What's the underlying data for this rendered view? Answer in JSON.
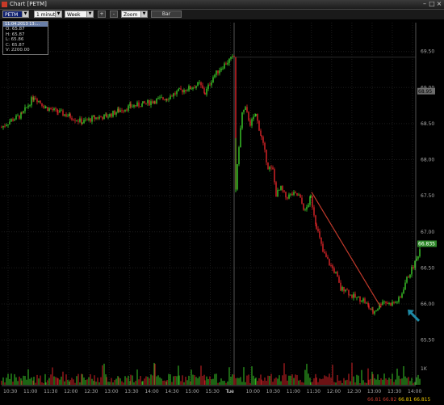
{
  "window": {
    "title": "Chart [PETM]"
  },
  "toolbar": {
    "symbol": "PETM",
    "interval": "1 minute",
    "period": "Week",
    "plus_label": "+",
    "minus_label": "-",
    "zoom": "Zoom",
    "bar_label": "Bar"
  },
  "infobox": {
    "header": "11.04.2013 13:...",
    "open": "O: 65.87",
    "high": "H: 65.87",
    "low": "L: 65.86",
    "close": "C: 65.87",
    "volume": "V: 2200.00"
  },
  "colors": {
    "up": "#3dcf2a",
    "down": "#e0262a",
    "line": "#c0392b",
    "arrow": "#1e8aa6"
  },
  "chart_data": {
    "type": "candlestick",
    "price_ticks": [
      "69.50",
      "69.00",
      "68.50",
      "68.00",
      "67.50",
      "67.00",
      "66.50",
      "66.00",
      "65.50"
    ],
    "y_range": [
      65.35,
      69.9
    ],
    "time_labels": [
      "10:30",
      "11:00",
      "11:30",
      "12:00",
      "12:30",
      "13:00",
      "13:30",
      "14:00",
      "14:30",
      "15:00",
      "15:30",
      "Tue",
      "10:00",
      "10:30",
      "11:00",
      "11:30",
      "12:00",
      "12:30",
      "13:00",
      "13:30",
      "14:00"
    ],
    "day_break_label": "Tue",
    "marker_price": "68.95",
    "last_price": "66.835",
    "volume_label": "1K",
    "footer_values": [
      "66.81",
      "66.82",
      "66.81",
      "66.815"
    ],
    "close_series": [
      [
        0,
        68.45
      ],
      [
        12,
        68.55
      ],
      [
        25,
        68.62
      ],
      [
        40,
        68.88
      ],
      [
        55,
        68.72
      ],
      [
        70,
        68.66
      ],
      [
        85,
        68.6
      ],
      [
        100,
        68.52
      ],
      [
        115,
        68.58
      ],
      [
        130,
        68.6
      ],
      [
        145,
        68.68
      ],
      [
        160,
        68.74
      ],
      [
        175,
        68.77
      ],
      [
        190,
        68.82
      ],
      [
        205,
        68.86
      ],
      [
        220,
        68.95
      ],
      [
        235,
        69.0
      ],
      [
        245,
        69.05
      ],
      [
        252,
        68.92
      ],
      [
        262,
        69.15
      ],
      [
        272,
        69.28
      ],
      [
        282,
        69.38
      ],
      [
        288,
        69.42
      ],
      [
        290,
        67.6
      ],
      [
        294,
        68.2
      ],
      [
        298,
        68.65
      ],
      [
        302,
        68.7
      ],
      [
        308,
        68.5
      ],
      [
        315,
        68.62
      ],
      [
        322,
        68.3
      ],
      [
        330,
        67.9
      ],
      [
        336,
        67.85
      ],
      [
        340,
        67.52
      ],
      [
        346,
        67.6
      ],
      [
        352,
        67.48
      ],
      [
        360,
        67.52
      ],
      [
        368,
        67.5
      ],
      [
        376,
        67.28
      ],
      [
        383,
        67.48
      ],
      [
        390,
        67.08
      ],
      [
        398,
        66.72
      ],
      [
        406,
        66.56
      ],
      [
        414,
        66.42
      ],
      [
        420,
        66.2
      ],
      [
        426,
        66.22
      ],
      [
        432,
        66.12
      ],
      [
        440,
        66.08
      ],
      [
        448,
        66.06
      ],
      [
        455,
        65.95
      ],
      [
        460,
        65.88
      ],
      [
        466,
        65.95
      ],
      [
        472,
        66.05
      ],
      [
        480,
        66.0
      ],
      [
        488,
        66.02
      ],
      [
        494,
        66.08
      ],
      [
        500,
        66.3
      ],
      [
        508,
        66.48
      ],
      [
        514,
        66.62
      ],
      [
        520,
        66.83
      ]
    ],
    "trendline": {
      "from": [
        384,
        67.55
      ],
      "to": [
        470,
        65.95
      ]
    },
    "arrow_at": [
      505,
      65.9
    ]
  }
}
